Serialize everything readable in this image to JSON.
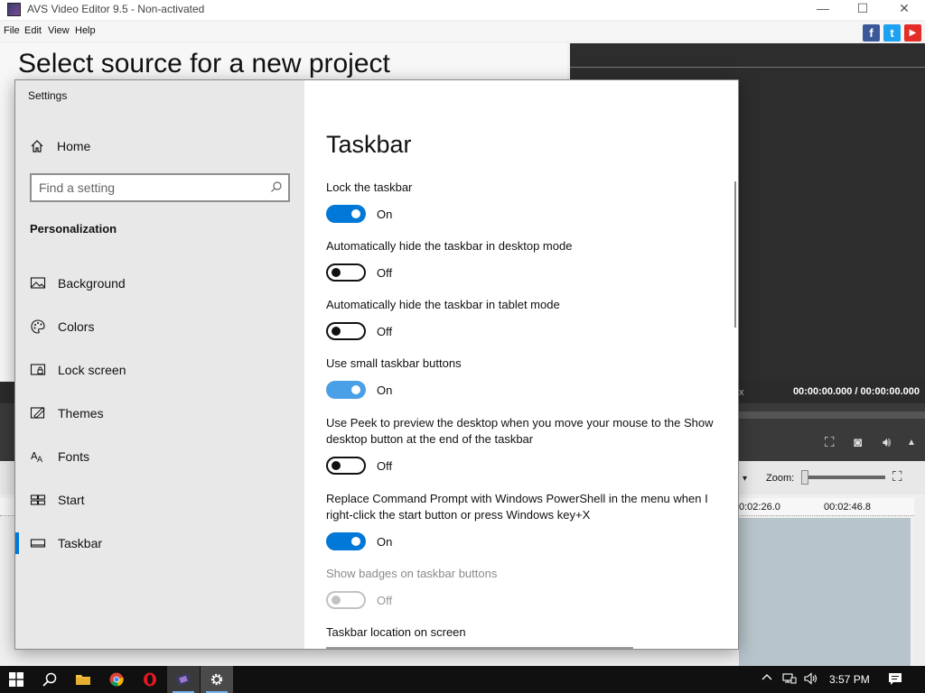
{
  "avs": {
    "title": "AVS Video Editor 9.5 - Non-activated",
    "window_buttons": {
      "minimize": "—",
      "maximize": "☐",
      "close": "✕"
    },
    "menu": [
      "File",
      "Edit",
      "View",
      "Help"
    ],
    "social": {
      "facebook": "f",
      "twitter": "t",
      "youtube": "▶"
    },
    "headline": "Select source for a new project",
    "preview_x_marker": "x",
    "timecode": "00:00:00.000  /  00:00:00.000",
    "zoom_label": "Zoom:",
    "ruler": [
      "0:02:26.0",
      "00:02:46.8"
    ],
    "dropdown_arrow": "▾"
  },
  "settings": {
    "window_title": "Settings",
    "home_label": "Home",
    "search_placeholder": "Find a setting",
    "section": "Personalization",
    "nav": [
      {
        "label": "Background",
        "icon": "image-icon"
      },
      {
        "label": "Colors",
        "icon": "palette-icon"
      },
      {
        "label": "Lock screen",
        "icon": "lock-screen-icon"
      },
      {
        "label": "Themes",
        "icon": "themes-icon"
      },
      {
        "label": "Fonts",
        "icon": "fonts-icon"
      },
      {
        "label": "Start",
        "icon": "start-icon"
      },
      {
        "label": "Taskbar",
        "icon": "taskbar-icon",
        "active": true
      }
    ],
    "heading": "Taskbar",
    "options": [
      {
        "label": "Lock the taskbar",
        "state": "On",
        "on": true
      },
      {
        "label": "Automatically hide the taskbar in desktop mode",
        "state": "Off",
        "on": false
      },
      {
        "label": "Automatically hide the taskbar in tablet mode",
        "state": "Off",
        "on": false
      },
      {
        "label": "Use small taskbar buttons",
        "state": "On",
        "on": true
      },
      {
        "label": "Use Peek to preview the desktop when you move your mouse to the Show desktop button at the end of the taskbar",
        "state": "Off",
        "on": false
      },
      {
        "label": "Replace Command Prompt with Windows PowerShell in the menu when I right-click the start button or press Windows key+X",
        "state": "On",
        "on": true
      },
      {
        "label": "Show badges on taskbar buttons",
        "state": "Off",
        "on": false,
        "disabled": true
      }
    ],
    "location_label": "Taskbar location on screen"
  },
  "taskbar": {
    "clock": "3:57 PM",
    "apps": [
      "start-icon",
      "search-icon",
      "file-explorer-icon",
      "chrome-icon",
      "opera-icon",
      "avs-video-editor-icon",
      "settings-gear-icon"
    ]
  },
  "colors": {
    "accent": "#0078d7",
    "toggle_light": "#4aa0e6",
    "facebook": "#3b5998",
    "twitter": "#1da1f2",
    "youtube": "#e52d27"
  }
}
